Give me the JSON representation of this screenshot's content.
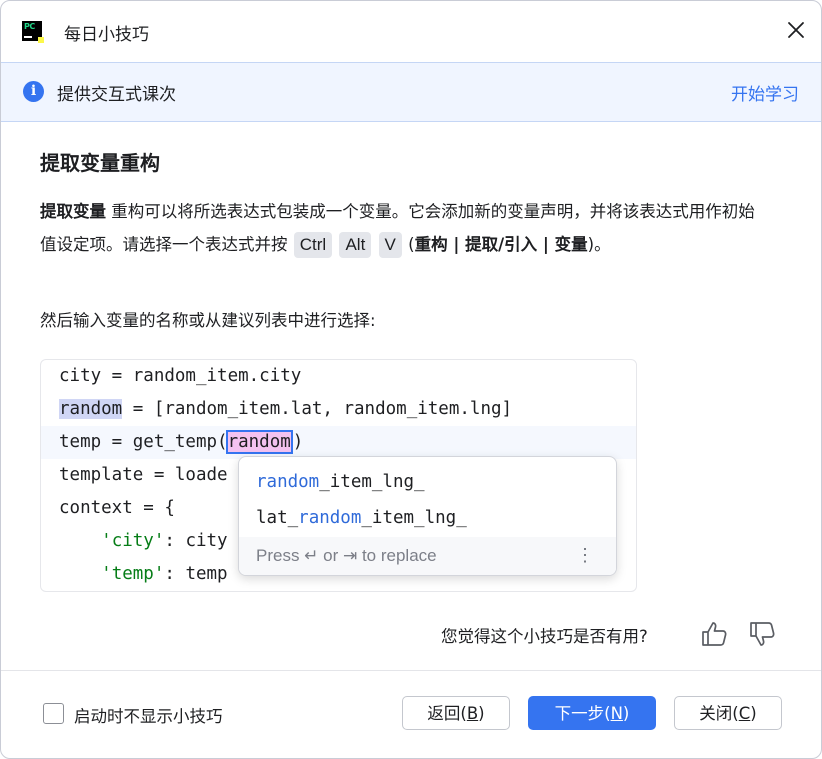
{
  "window": {
    "title": "每日小技巧",
    "app_icon_text": "PC"
  },
  "banner": {
    "text": "提供交互式课次",
    "link": "开始学习"
  },
  "tip": {
    "title": "提取变量重构",
    "bold_term": "提取变量",
    "body_1": " 重构可以将所选表达式包装成一个变量。它会添加新的变量声明，并将该表达式用作初始值设定项。请选择一个表达式并按 ",
    "keys": [
      "Ctrl",
      "Alt",
      "V"
    ],
    "path_open": " (",
    "path": "重构 | 提取/引入 | 变量",
    "path_close": ")。",
    "body_2": "然后输入变量的名称或从建议列表中进行选择:"
  },
  "code": {
    "line1": "city = random_item.city",
    "line2_var": "random",
    "line2_rest": " = [random_item.lat, random_item.lng]",
    "line3_pre": "temp = get_temp(",
    "line3_var": "random",
    "line3_post": ")",
    "line4": "template = loade",
    "line5": "context = {",
    "line6_str": "'city'",
    "line6_rest": ": city",
    "line7_str": "'temp'",
    "line7_rest": ": temp"
  },
  "popup": {
    "items": [
      {
        "match": "random",
        "rest": "_item_lng_"
      },
      {
        "pre": "lat_",
        "match": "random",
        "rest": "_item_lng_"
      }
    ],
    "hint": "Press ↵ or ⇥ to replace",
    "more": "⋮"
  },
  "feedback": {
    "question": "您觉得这个小技巧是否有用?"
  },
  "footer": {
    "checkbox_label": "启动时不显示小技巧",
    "checkbox_checked": false,
    "back": {
      "label": "返回(",
      "mnemonic": "B",
      "close": ")"
    },
    "next": {
      "label": "下一步(",
      "mnemonic": "N",
      "close": ")"
    },
    "close": {
      "label": "关闭(",
      "mnemonic": "C",
      "close": ")"
    }
  },
  "colors": {
    "accent": "#3574f0",
    "banner_bg": "#f0f5ff",
    "string": "#067d17"
  }
}
